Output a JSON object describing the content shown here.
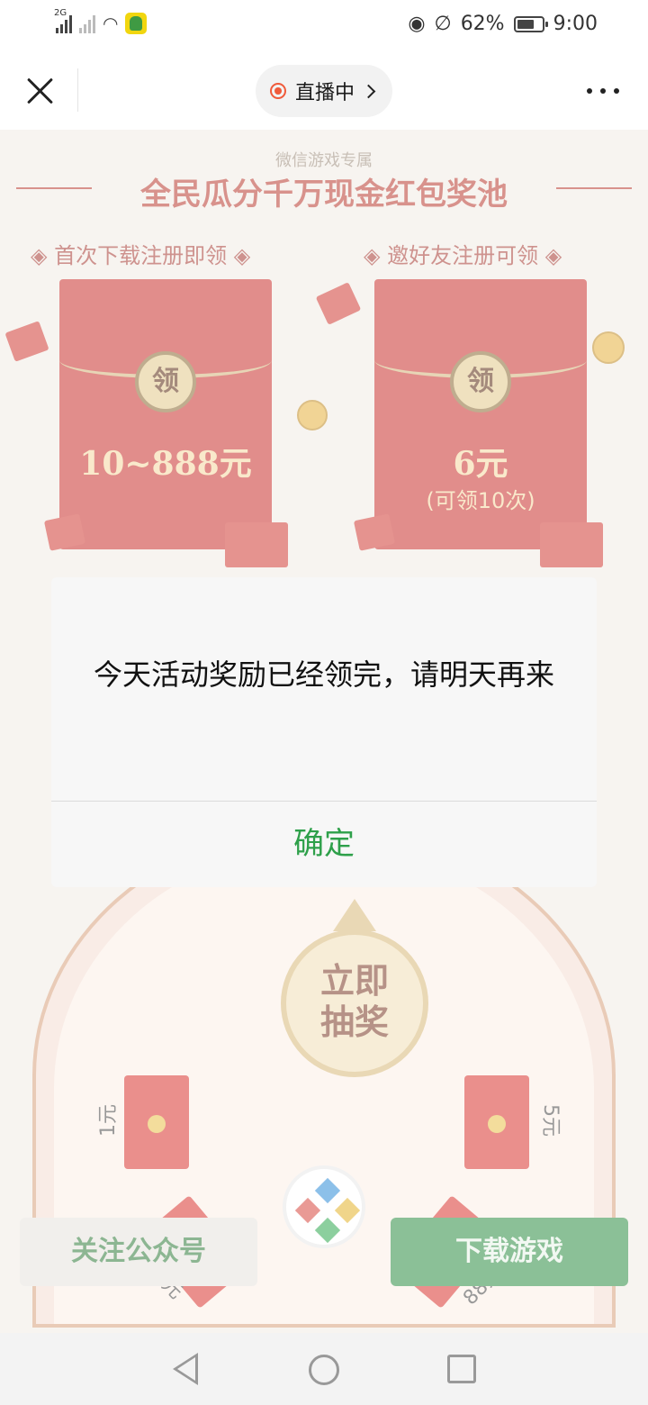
{
  "status_bar": {
    "network": "2G",
    "battery_percent": "62%",
    "time": "9:00"
  },
  "nav": {
    "live_label": "直播中"
  },
  "game_page": {
    "header_subtitle": "微信游戏专属",
    "header_title": "全民瓜分千万现金红包奖池",
    "left_card": {
      "title": "◈ 首次下载注册即领 ◈",
      "seal": "领",
      "amount": "10~888元"
    },
    "right_card": {
      "title": "◈ 邀好友注册可领 ◈",
      "seal": "领",
      "amount": "6元",
      "note": "(可领10次)"
    },
    "wheel": {
      "center_line1": "立即",
      "center_line2": "抽奖",
      "prizes": [
        "1元",
        "5元",
        "3元",
        "88元"
      ]
    },
    "follow_button": "关注公众号",
    "download_button": "下载游戏"
  },
  "dialog": {
    "message": "今天活动奖励已经领完，请明天再来",
    "confirm_label": "确定"
  },
  "colors": {
    "accent_green": "#2ea04a",
    "red_envelope": "#c9302c"
  }
}
